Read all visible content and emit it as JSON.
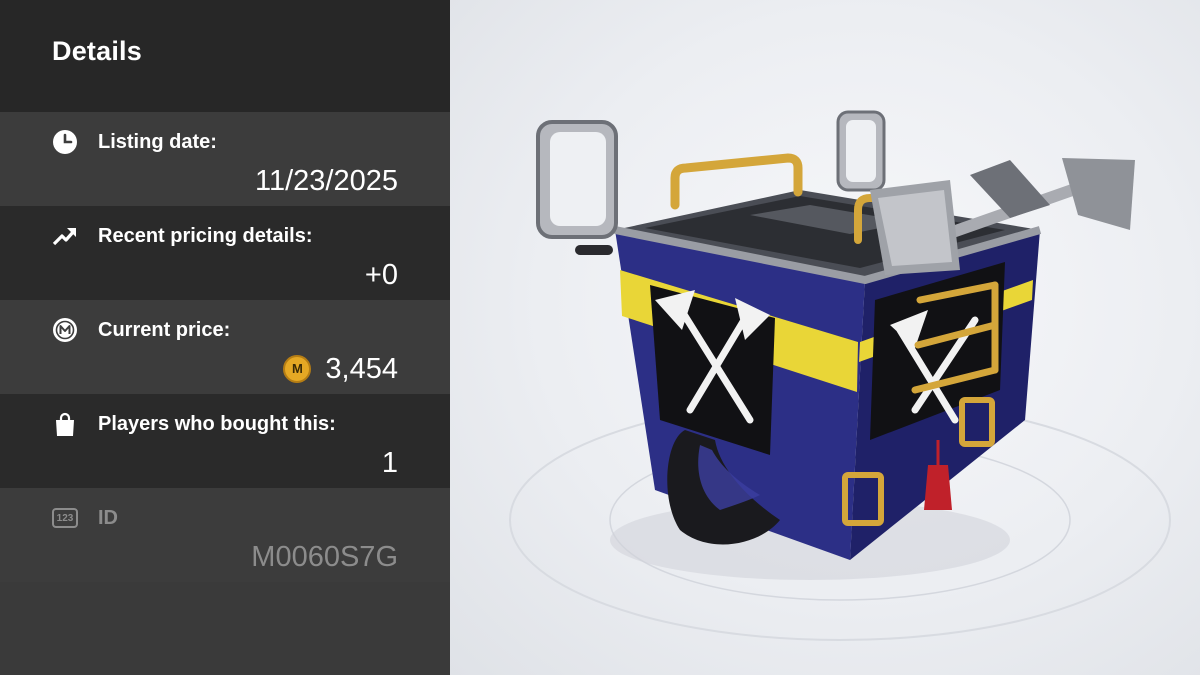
{
  "panel": {
    "title": "Details",
    "listing_date": {
      "label": "Listing date:",
      "value": "11/23/2025",
      "icon": "clock-icon"
    },
    "pricing": {
      "label": "Recent pricing details:",
      "value": "+0",
      "icon": "trend-up-icon"
    },
    "price": {
      "label": "Current price:",
      "coin_letter": "M",
      "value": "3,454",
      "icon": "medal-coin-icon"
    },
    "buyers": {
      "label": "Players who bought this:",
      "value": "1",
      "icon": "shopping-bag-icon"
    },
    "id": {
      "label": "ID",
      "value": "M0060S7G",
      "badge_text": "123",
      "icon": "number-badge-icon"
    }
  },
  "colors": {
    "panel_bg": "#3a3a3a",
    "header_bg": "#272727",
    "coin_gold": "#e5a824",
    "muted_text": "#8c8c8c"
  },
  "viewer": {
    "item": "box-shaped kart body with mirrors and pickaxe emblem",
    "body_color": "#2c2f86",
    "stripe_color": "#e9d637"
  }
}
